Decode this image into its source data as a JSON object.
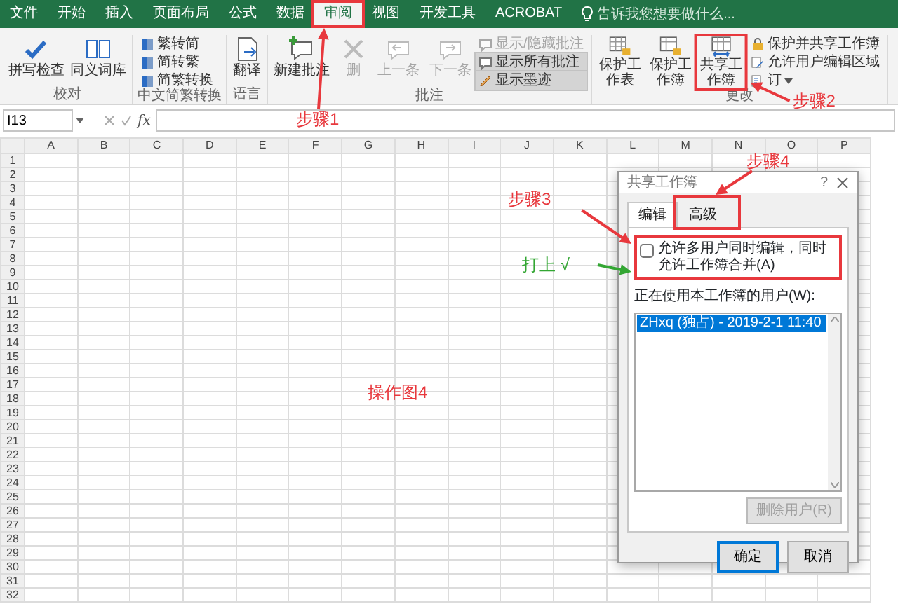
{
  "ribbon_tabs": [
    {
      "label": "文件",
      "selected": false
    },
    {
      "label": "开始",
      "selected": false
    },
    {
      "label": "插入",
      "selected": false
    },
    {
      "label": "页面布局",
      "selected": false
    },
    {
      "label": "公式",
      "selected": false
    },
    {
      "label": "数据",
      "selected": false
    },
    {
      "label": "审阅",
      "selected": true
    },
    {
      "label": "视图",
      "selected": false
    },
    {
      "label": "开发工具",
      "selected": false
    },
    {
      "label": "ACROBAT",
      "selected": false
    }
  ],
  "tell_me": {
    "placeholder": "告诉我您想要做什么..."
  },
  "ribbon_groups": [
    {
      "label": "校对",
      "items": [
        {
          "label": "拼写检查",
          "kind": "large",
          "disabled": false,
          "on": false
        },
        {
          "label": "同义词库",
          "kind": "large",
          "disabled": false,
          "on": false
        }
      ]
    },
    {
      "label": "中文简繁转换",
      "items": [
        {
          "label": "繁转简",
          "kind": "small",
          "disabled": false,
          "on": false
        },
        {
          "label": "简转繁",
          "kind": "small",
          "disabled": false,
          "on": false
        },
        {
          "label": "简繁转换",
          "kind": "small",
          "disabled": false,
          "on": false
        }
      ]
    },
    {
      "label": "语言",
      "items": [
        {
          "label": "翻译",
          "kind": "large",
          "disabled": false,
          "on": false
        }
      ]
    },
    {
      "label": "批注",
      "items": [
        {
          "label": "新建批注",
          "kind": "large",
          "disabled": false,
          "on": false
        },
        {
          "label": "删",
          "kind": "large",
          "disabled": true,
          "on": false
        },
        {
          "label": "上一条",
          "kind": "large",
          "disabled": true,
          "on": false
        },
        {
          "label": "下一条",
          "kind": "large",
          "disabled": true,
          "on": false
        },
        {
          "label": "显示/隐藏批注",
          "kind": "small",
          "disabled": true,
          "on": false
        },
        {
          "label": "显示所有批注",
          "kind": "small",
          "disabled": false,
          "on": true
        },
        {
          "label": "显示墨迹",
          "kind": "small",
          "disabled": false,
          "on": true
        }
      ]
    },
    {
      "label": "更改",
      "items": [
        {
          "label": "保护工作表",
          "kind": "tall",
          "disabled": false,
          "on": false
        },
        {
          "label": "保护工作簿",
          "kind": "tall",
          "disabled": false,
          "on": false
        },
        {
          "label": "共享工作簿",
          "kind": "tall",
          "disabled": false,
          "on": false
        },
        {
          "label": "保护并共享工作簿",
          "kind": "small",
          "disabled": false,
          "on": false
        },
        {
          "label": "允许用户编辑区域",
          "kind": "small",
          "disabled": false,
          "on": false
        },
        {
          "label": "订",
          "kind": "dropdown",
          "disabled": false,
          "on": false
        }
      ]
    }
  ],
  "formula_bar": {
    "name_box": "I13",
    "fx": "fx"
  },
  "sheet": {
    "columns": [
      "A",
      "B",
      "C",
      "D",
      "E",
      "F",
      "G",
      "H",
      "I",
      "J",
      "K",
      "L",
      "M",
      "N",
      "O",
      "P"
    ],
    "rows": [
      "1",
      "2",
      "3",
      "4",
      "5",
      "6",
      "7",
      "8",
      "9",
      "10",
      "11",
      "12",
      "13",
      "14",
      "15",
      "16",
      "17",
      "18",
      "19",
      "20",
      "21",
      "22",
      "23",
      "24",
      "25",
      "26",
      "27",
      "28",
      "29",
      "30",
      "31",
      "32"
    ]
  },
  "dialog": {
    "title": "共享工作簿",
    "help": "?",
    "tabs": [
      {
        "label": "编辑",
        "selected": true
      },
      {
        "label": "高级",
        "selected": false
      }
    ],
    "share_option": {
      "label": "允许多用户同时编辑，同时允许工作簿合并(A)",
      "checked": false
    },
    "users_label": "正在使用本工作簿的用户(W):",
    "users": [
      {
        "text": "ZHxq (独占) - 2019-2-1 11:40",
        "selected": true
      }
    ],
    "remove_button": {
      "label": "删除用户(R)",
      "disabled": true
    },
    "buttons": [
      "确定",
      "取消"
    ]
  },
  "annotations": [
    {
      "text": "步骤1",
      "color": "#e8383d"
    },
    {
      "text": "步骤2",
      "color": "#e8383d"
    },
    {
      "text": "步骤3",
      "color": "#e8383d"
    },
    {
      "text": "步骤4",
      "color": "#e8383d"
    },
    {
      "text": "打上 √",
      "color": "#33a633"
    },
    {
      "text": "操作图4",
      "color": "#e8383d"
    }
  ]
}
